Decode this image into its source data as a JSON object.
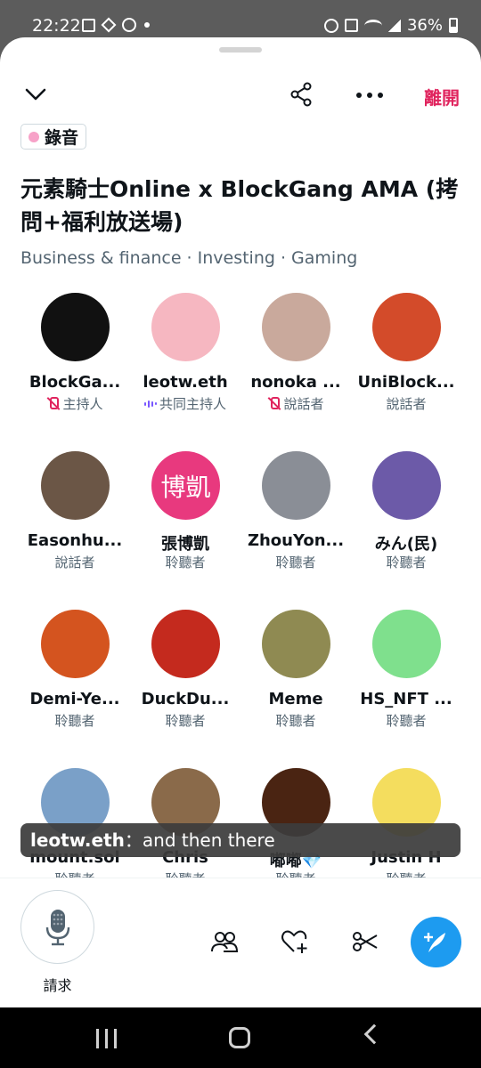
{
  "status_bar": {
    "time": "22:22",
    "battery": "36%",
    "icons": [
      "gallery-icon",
      "binance-icon",
      "c-app-icon",
      "dot-icon",
      "alarm-icon",
      "mute-icon",
      "wifi-icon",
      "signal-icon",
      "battery-icon"
    ]
  },
  "header": {
    "leave_label": "離開",
    "icons": [
      "chevron-down-icon",
      "share-icon",
      "more-icon"
    ]
  },
  "recording_badge": {
    "label": "錄音",
    "dot_color": "#f7a2c8"
  },
  "space": {
    "title": "元素騎士Online x BlockGang AMA (拷問+福利放送場)",
    "topics": "Business & finance · Investing · Gaming"
  },
  "participants": [
    {
      "name": "BlockGa...",
      "role": "主持人",
      "role_icon": "mic-muted-icon",
      "avatar_bg": "#111111",
      "avatar_text": ""
    },
    {
      "name": "leotw.eth",
      "role": "共同主持人",
      "role_icon": "speaking-wave-icon",
      "avatar_bg": "#f6b7c1",
      "avatar_text": ""
    },
    {
      "name": "nonoka ...",
      "role": "說話者",
      "role_icon": "mic-muted-icon",
      "avatar_bg": "#c9a99c",
      "avatar_text": ""
    },
    {
      "name": "UniBlock...",
      "role": "說話者",
      "role_icon": "",
      "avatar_bg": "#d34b2a",
      "avatar_text": ""
    },
    {
      "name": "Easonhu...",
      "role": "說話者",
      "role_icon": "",
      "avatar_bg": "#6b5646",
      "avatar_text": ""
    },
    {
      "name": "張博凱",
      "role": "聆聽者",
      "role_icon": "",
      "avatar_bg": "#e8397e",
      "avatar_text": "博凱"
    },
    {
      "name": "ZhouYon...",
      "role": "聆聽者",
      "role_icon": "",
      "avatar_bg": "#8a8e96",
      "avatar_text": ""
    },
    {
      "name": "みん(民)",
      "role": "聆聽者",
      "role_icon": "",
      "avatar_bg": "#6c5aa8",
      "avatar_text": ""
    },
    {
      "name": "Demi-Ye...",
      "role": "聆聽者",
      "role_icon": "",
      "avatar_bg": "#d4541f",
      "avatar_text": ""
    },
    {
      "name": "DuckDu...",
      "role": "聆聽者",
      "role_icon": "",
      "avatar_bg": "#c42a1e",
      "avatar_text": ""
    },
    {
      "name": "Meme",
      "role": "聆聽者",
      "role_icon": "",
      "avatar_bg": "#8f8a52",
      "avatar_text": ""
    },
    {
      "name": "HS_NFT ...",
      "role": "聆聽者",
      "role_icon": "",
      "avatar_bg": "#7fe08d",
      "avatar_text": ""
    },
    {
      "name": "mount.sol",
      "role": "聆聽者",
      "role_icon": "",
      "avatar_bg": "#7aa0c8",
      "avatar_text": ""
    },
    {
      "name": "Chris",
      "role": "聆聽者",
      "role_icon": "",
      "avatar_bg": "#8a6a4a",
      "avatar_text": ""
    },
    {
      "name": "嘟嘟💎",
      "role": "聆聽者",
      "role_icon": "",
      "avatar_bg": "#4a2412",
      "avatar_text": ""
    },
    {
      "name": "Justin H",
      "role": "聆聽者",
      "role_icon": "",
      "avatar_bg": "#f4dd5e",
      "avatar_text": ""
    }
  ],
  "caption": {
    "speaker": "leotw.eth",
    "separator": "：",
    "text": "and then there"
  },
  "bottom_bar": {
    "request_label": "請求",
    "icons": [
      "microphone-icon",
      "people-icon",
      "heart-plus-icon",
      "scissors-icon",
      "compose-icon"
    ],
    "accent_color": "#1d9bf0"
  },
  "nav_bar": {
    "icons": [
      "recents-icon",
      "home-icon",
      "back-icon"
    ]
  }
}
